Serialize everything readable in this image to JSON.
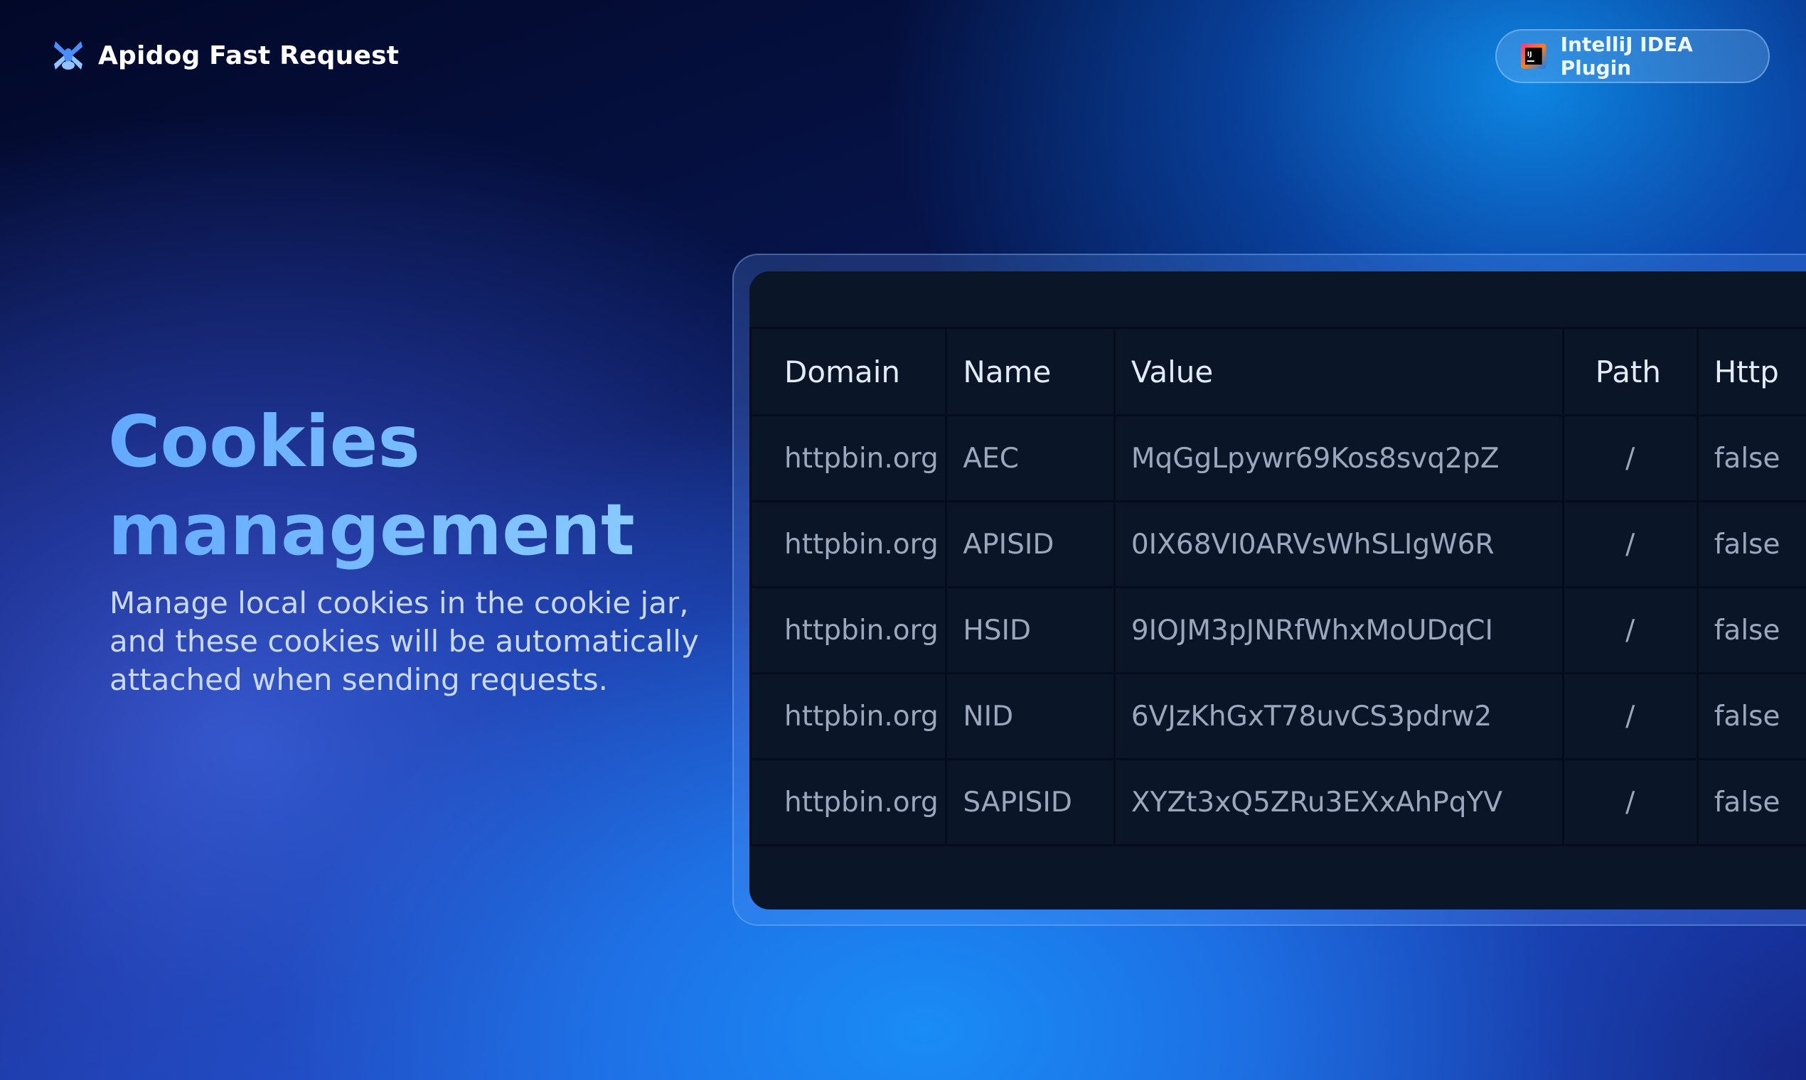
{
  "brand": {
    "name": "Apidog Fast Request",
    "icon": "apidog-logo-icon",
    "colors": {
      "logo_primary": "#4a8dff",
      "logo_accent": "#8fc4ff"
    }
  },
  "plugin_button": {
    "label": "IntelliJ IDEA Plugin",
    "icon": "intellij-idea-icon"
  },
  "hero": {
    "title": "Cookies management",
    "subtitle": "Manage local cookies in the cookie jar, and these cookies will be automatically attached when sending requests."
  },
  "cookie_table": {
    "columns": [
      "Domain",
      "Name",
      "Value",
      "Path",
      "Http"
    ],
    "rows": [
      {
        "domain": "httpbin.org",
        "name": "AEC",
        "value": "MqGgLpywr69Kos8svq2pZ",
        "path": "/",
        "http": "false"
      },
      {
        "domain": "httpbin.org",
        "name": "APISID",
        "value": "0IX68VI0ARVsWhSLIgW6R",
        "path": "/",
        "http": "false"
      },
      {
        "domain": "httpbin.org",
        "name": "HSID",
        "value": "9IOJM3pJNRfWhxMoUDqCI",
        "path": "/",
        "http": "false"
      },
      {
        "domain": "httpbin.org",
        "name": "NID",
        "value": "6VJzKhGxT78uvCS3pdrw2",
        "path": "/",
        "http": "false"
      },
      {
        "domain": "httpbin.org",
        "name": "SAPISID",
        "value": "XYZt3xQ5ZRu3EXxAhPqYV",
        "path": "/",
        "http": "false"
      }
    ]
  },
  "colors": {
    "background_dark": "#030a2e",
    "background_blue": "#1a8cf0",
    "title_gradient_start": "#62a9ff",
    "title_gradient_end": "#8fd0ff",
    "table_background": "#0a1628"
  }
}
